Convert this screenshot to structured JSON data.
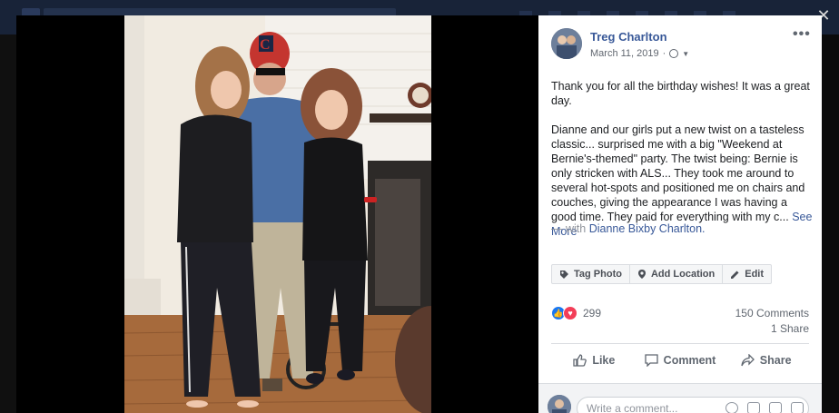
{
  "post": {
    "author": "Treg Charlton",
    "date": "March 11, 2019",
    "paragraph1": "Thank you for all the birthday wishes! It was a great day.",
    "paragraph2": "Dianne and our girls put a new twist on a tasteless classic... surprised me with a big \"Weekend at Bernie's-themed\" party. The twist being: Bernie is only stricken with ALS... They took me around to several hot-spots and positioned me on chairs and couches, giving the appearance I was having a good time. They paid for everything with my c...",
    "see_more": "See More",
    "with_prefix": "— with",
    "tagged_name": "Dianne Bixby Charlton."
  },
  "photo_actions": {
    "tag_photo": "Tag Photo",
    "add_location": "Add Location",
    "edit": "Edit"
  },
  "stats": {
    "reactions": "299",
    "comments": "150 Comments",
    "shares": "1 Share"
  },
  "buttons": {
    "like": "Like",
    "comment": "Comment",
    "share": "Share"
  },
  "comment_box": {
    "placeholder": "Write a comment..."
  },
  "icons": {
    "close": "close-icon",
    "more": "more-options-icon",
    "privacy": "globe-icon",
    "tag": "tag-icon",
    "location": "location-pin-icon",
    "edit": "pencil-icon",
    "like_reaction": "like-reaction-icon",
    "love_reaction": "love-reaction-icon"
  },
  "colors": {
    "link": "#385898",
    "like_blue": "#1877f2",
    "love_red": "#f33e58",
    "overlay": "#0b0b0b"
  }
}
